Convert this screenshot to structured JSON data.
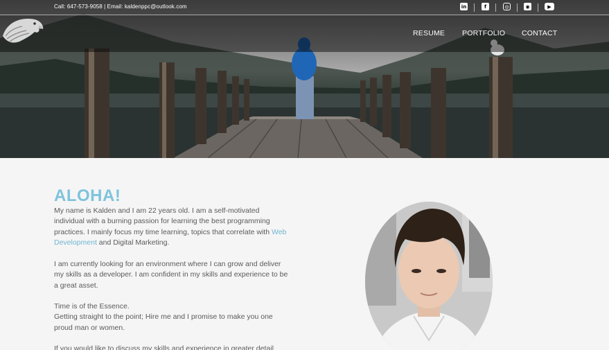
{
  "header": {
    "contact_line": "Call: 647-573-9058 | Email: kaldenppc@outlook.com",
    "social_icons": [
      "linkedin-icon",
      "facebook-icon",
      "instagram-icon",
      "github-icon",
      "youtube-icon"
    ]
  },
  "nav": {
    "items": [
      {
        "label": "RESUME"
      },
      {
        "label": "PORTFOLIO"
      },
      {
        "label": "CONTACT"
      }
    ]
  },
  "about": {
    "heading": "ALOHA!",
    "p1_before": "My name is Kalden and I am 22 years old. I am a self-motivated individual with a burning passion for learning the best programming practices. I mainly focus my time learning, topics that correlate with ",
    "p1_link": "Web Development",
    "p1_after": " and Digital Marketing.",
    "p2": "I am currently looking for an environment where I can grow and deliver my skills as a developer. I am confident in my skills and experience to be a great asset.",
    "p3_line1": "Time is of the Essence.",
    "p3_line2": "Getting straight to the point; Hire me and I promise to make you one proud man or women.",
    "p4": "If you would like to discuss my skills and experience in greater detail"
  },
  "colors": {
    "accent": "#7ec3dc",
    "link": "#6fb5d3",
    "body_text": "#5a5a5a",
    "background": "#f5f5f5"
  }
}
